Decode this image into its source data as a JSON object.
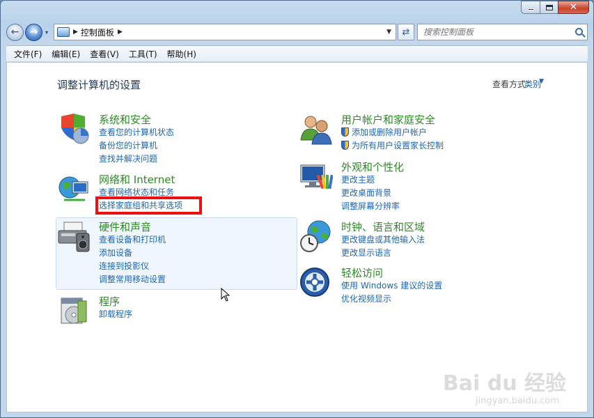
{
  "window": {
    "caption": {
      "minimize": "—",
      "maximize": "□",
      "close": "✕"
    }
  },
  "nav": {
    "back_glyph": "←",
    "forward_glyph": "→",
    "dropdown_glyph": "▾",
    "breadcrumb_sep": "▶",
    "breadcrumb": "控制面板",
    "breadcrumb_sep2": "▶",
    "address_dropdown": "▼",
    "refresh_glyph": "⇄",
    "search_placeholder": "搜索控制面板"
  },
  "menubar": {
    "items": [
      "文件(F)",
      "编辑(E)",
      "查看(V)",
      "工具(T)",
      "帮助(H)"
    ]
  },
  "page": {
    "title": "调整计算机的设置",
    "view_by_label": "查看方式:",
    "view_by_value": "类别",
    "view_by_arrow": "▼"
  },
  "categories": [
    {
      "title": "系统和安全",
      "icon": "shield-pie-icon",
      "links": [
        "查看您的计算机状态",
        "备份您的计算机",
        "查找并解决问题"
      ]
    },
    {
      "title": "网络和 Internet",
      "icon": "globe-network-icon",
      "links": [
        "查看网络状态和任务",
        "选择家庭组和共享选项"
      ]
    },
    {
      "title": "硬件和声音",
      "icon": "printer-speaker-icon",
      "links": [
        "查看设备和打印机",
        "添加设备",
        "连接到投影仪",
        "调整常用移动设置"
      ]
    },
    {
      "title": "程序",
      "icon": "programs-disc-icon",
      "links": [
        "卸载程序"
      ]
    },
    {
      "title": "用户帐户和家庭安全",
      "icon": "users-icon",
      "links": [
        "添加或删除用户帐户",
        "为所有用户设置家长控制"
      ]
    },
    {
      "title": "外观和个性化",
      "icon": "monitor-palette-icon",
      "links": [
        "更改主题",
        "更改桌面背景",
        "调整屏幕分辨率"
      ]
    },
    {
      "title": "时钟、语言和区域",
      "icon": "clock-globe-icon",
      "links": [
        "更改键盘或其他输入法",
        "更改显示语言"
      ]
    },
    {
      "title": "轻松访问",
      "icon": "ease-of-access-icon",
      "links": [
        "使用 Windows 建议的设置",
        "优化视频显示"
      ]
    }
  ],
  "watermark": {
    "main": "Bai du 经验",
    "sub": "jingyan.baidu.com"
  },
  "colors": {
    "category_title": "#2e8b26",
    "link": "#1e66b8",
    "highlight": "#ee1010"
  }
}
